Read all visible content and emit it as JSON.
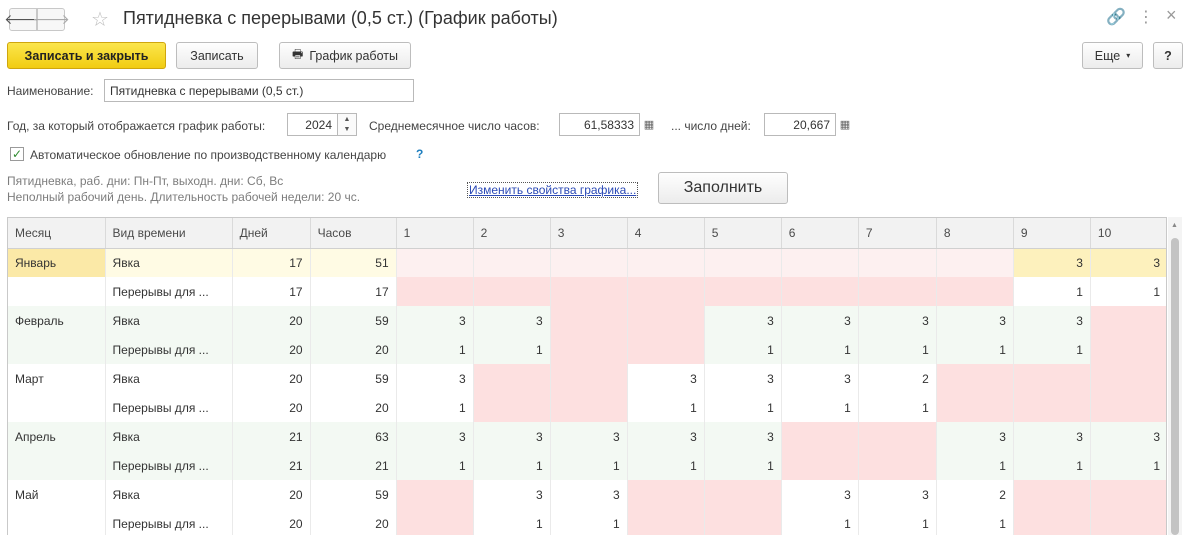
{
  "window": {
    "title": "Пятидневка с перерывами (0,5 ст.) (График работы)",
    "back_glyph": "🡐",
    "forward_glyph": "🡒",
    "star_glyph": "☆",
    "link_glyph": "🔗",
    "more_glyph": "⋮",
    "close_glyph": "×"
  },
  "toolbar": {
    "save_close_label": "Записать и закрыть",
    "save_label": "Записать",
    "schedule_label": "График работы",
    "schedule_glyph": "🖶",
    "more_label": "Еще",
    "more_caret": "▾",
    "help_label": "?"
  },
  "form": {
    "name_label": "Наименование:",
    "name_value": "Пятидневка с перерывами (0,5 ст.)",
    "year_label": "Год, за который отображается график работы:",
    "year_value": "2024",
    "spin_up": "▲",
    "spin_down": "▼",
    "hours_label": "Среднемесячное число часов:",
    "hours_value": "61,58333",
    "days_label": "... число дней:",
    "days_value": "20,667",
    "calc_glyph": "▦",
    "auto_update_label": "Автоматическое обновление по производственному календарю",
    "auto_update_checked": true,
    "check_glyph": "✓",
    "help_glyph": "?",
    "info_line1": "Пятидневка, раб. дни: Пн-Пт, выходн. дни: Сб, Вс",
    "info_line2": "Неполный рабочий день. Длительность рабочей недели: 20 чс.",
    "change_link": "Изменить свойства графика...",
    "fill_button": "Заполнить"
  },
  "grid": {
    "headers": [
      "Месяц",
      "Вид времени",
      "Дней",
      "Часов",
      "1",
      "2",
      "3",
      "4",
      "5",
      "6",
      "7",
      "8",
      "9",
      "10"
    ],
    "rows": [
      {
        "month": "Январь",
        "kind": "Явка",
        "days": "17",
        "hours": "51",
        "cells": [
          "",
          "",
          "",
          "",
          "",
          "",
          "",
          "",
          "3",
          "3"
        ]
      },
      {
        "month": "",
        "kind": "Перерывы для ...",
        "days": "17",
        "hours": "17",
        "cells": [
          "",
          "",
          "",
          "",
          "",
          "",
          "",
          "",
          "1",
          "1"
        ]
      },
      {
        "month": "Февраль",
        "kind": "Явка",
        "days": "20",
        "hours": "59",
        "cells": [
          "3",
          "3",
          "",
          "",
          "3",
          "3",
          "3",
          "3",
          "3",
          ""
        ]
      },
      {
        "month": "",
        "kind": "Перерывы для ...",
        "days": "20",
        "hours": "20",
        "cells": [
          "1",
          "1",
          "",
          "",
          "1",
          "1",
          "1",
          "1",
          "1",
          ""
        ]
      },
      {
        "month": "Март",
        "kind": "Явка",
        "days": "20",
        "hours": "59",
        "cells": [
          "3",
          "",
          "",
          "3",
          "3",
          "3",
          "2",
          "",
          "",
          ""
        ]
      },
      {
        "month": "",
        "kind": "Перерывы для ...",
        "days": "20",
        "hours": "20",
        "cells": [
          "1",
          "",
          "",
          "1",
          "1",
          "1",
          "1",
          "",
          "",
          ""
        ]
      },
      {
        "month": "Апрель",
        "kind": "Явка",
        "days": "21",
        "hours": "63",
        "cells": [
          "3",
          "3",
          "3",
          "3",
          "3",
          "",
          "",
          "3",
          "3",
          "3"
        ]
      },
      {
        "month": "",
        "kind": "Перерывы для ...",
        "days": "21",
        "hours": "21",
        "cells": [
          "1",
          "1",
          "1",
          "1",
          "1",
          "",
          "",
          "1",
          "1",
          "1"
        ]
      },
      {
        "month": "Май",
        "kind": "Явка",
        "days": "20",
        "hours": "59",
        "cells": [
          "",
          "3",
          "3",
          "",
          "",
          "3",
          "3",
          "2",
          "",
          ""
        ]
      },
      {
        "month": "",
        "kind": "Перерывы для ...",
        "days": "20",
        "hours": "20",
        "cells": [
          "",
          "1",
          "1",
          "",
          "",
          "1",
          "1",
          "1",
          "",
          ""
        ]
      }
    ],
    "non_working_days": {
      "Январь": [
        1,
        2,
        3,
        4,
        5,
        6,
        7,
        8
      ],
      "Февраль": [
        3,
        4,
        10
      ],
      "Март": [
        2,
        3,
        8,
        9,
        10
      ],
      "Апрель": [
        6,
        7
      ],
      "Май": [
        1,
        4,
        5,
        9,
        10
      ]
    },
    "colors": {
      "non_working": "#fde0e0",
      "selected_row": "#fffbe4",
      "selected_cell": "#fbe9a7",
      "alt_row": "#f3f9f3"
    }
  }
}
